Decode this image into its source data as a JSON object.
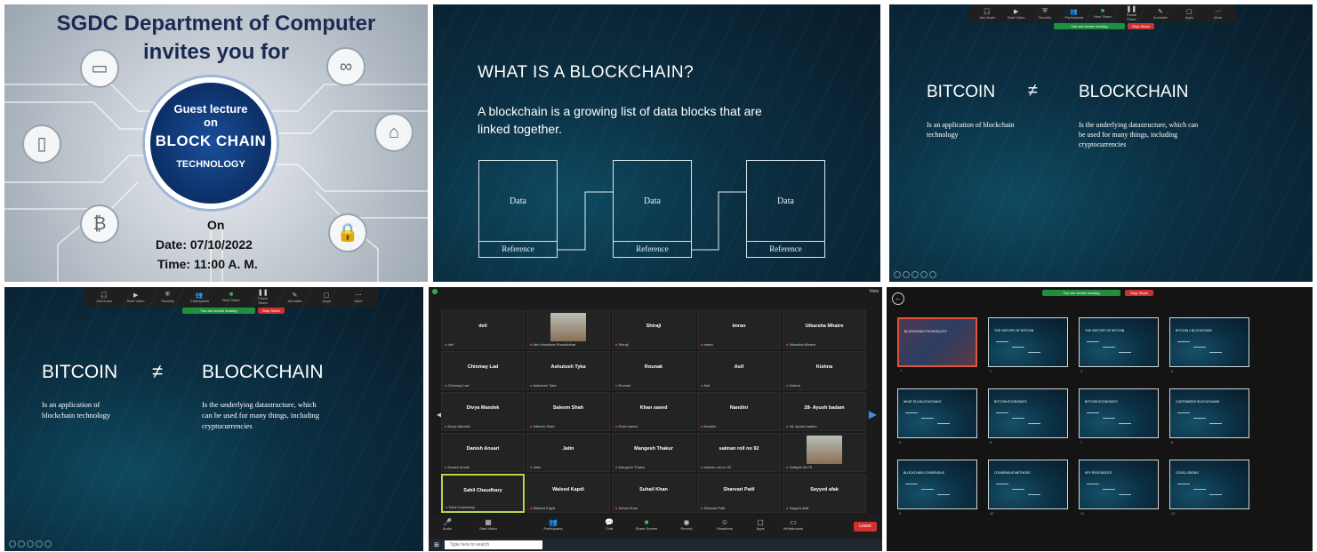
{
  "panel1": {
    "title_line1": "SGDC Department of Computer",
    "title_line2": "invites you for",
    "badge": {
      "line1": "Guest lecture",
      "line2": "on",
      "line3": "BLOCK CHAIN",
      "line4": "TECHNOLOGY"
    },
    "on": "On",
    "date": "Date: 07/10/2022",
    "time": "Time: 11:00 A. M."
  },
  "panel2": {
    "heading": "WHAT IS A BLOCKCHAIN?",
    "body": "A blockchain is a growing list of data blocks that are linked together.",
    "blocks": [
      {
        "data": "Data",
        "ref": "Reference"
      },
      {
        "data": "Data",
        "ref": "Reference"
      },
      {
        "data": "Data",
        "ref": "Reference"
      }
    ]
  },
  "comparison": {
    "left_title": "BITCOIN",
    "symbol": "≠",
    "right_title": "BLOCKCHAIN",
    "left_desc": "Is an application of blockchain technology",
    "right_desc": "Is the underlying datastructure, which can be used for many things, including cryptocurrencies"
  },
  "share_toolbar": {
    "items": [
      "Join Audio",
      "Start Video",
      "Security",
      "Participants",
      "New Share",
      "Pause Share",
      "Annotate",
      "Apps",
      "More"
    ],
    "banner": "You are screen sharing",
    "stop": "Stop Share"
  },
  "gallery": {
    "tiles": [
      {
        "name": "dell",
        "label": "dell"
      },
      {
        "name": "",
        "label": "Anu Harshima Shankhdhar",
        "photo": true
      },
      {
        "name": "Shiraji",
        "label": "Shiraji"
      },
      {
        "name": "Imran",
        "label": "Imran"
      },
      {
        "name": "Utkarsha Mhatre",
        "label": "Utkarsha Mhatre"
      },
      {
        "name": "Chinmay Lad",
        "label": "Chinmay Lad"
      },
      {
        "name": "Ashutosh Tyka",
        "label": "Ashutosh Tyka"
      },
      {
        "name": "Rounak",
        "label": "Rounak"
      },
      {
        "name": "Asif",
        "label": "Asif"
      },
      {
        "name": "Kishna",
        "label": "Kishna"
      },
      {
        "name": "Divya Mandek",
        "label": "Divya Mandek"
      },
      {
        "name": "Saleem Shah",
        "label": "Saleem Shah"
      },
      {
        "name": "Khan saeed",
        "label": "Khan saeed"
      },
      {
        "name": "Nandini",
        "label": "Nandini"
      },
      {
        "name": "28- Ayush badam",
        "label": "28- Ayush badam"
      },
      {
        "name": "Danish Ansari",
        "label": "Danish Ansari"
      },
      {
        "name": "Jatin",
        "label": "Jatin"
      },
      {
        "name": "Mangesh Thakur",
        "label": "Mangesh Thakur"
      },
      {
        "name": "salman roll no 92",
        "label": "salman roll no 92"
      },
      {
        "name": "",
        "label": "Tadhpal 36 FE",
        "photo": true
      },
      {
        "name": "Sahil Chaudhary",
        "label": "Sahil Chaudhary",
        "selected": true
      },
      {
        "name": "Waleed Kapdi",
        "label": "Waleed Kapdi"
      },
      {
        "name": "Suhail Khan",
        "label": "Suhail Khan"
      },
      {
        "name": "Sharvari Patil",
        "label": "Sharvari Patil"
      },
      {
        "name": "Sayyed afak",
        "label": "Sayyed afak"
      }
    ],
    "view_label": "View",
    "controls": [
      "Audio",
      "Start Video",
      "Participants",
      "Chat",
      "Share Screen",
      "Record",
      "Reactions",
      "Apps",
      "Whiteboards"
    ],
    "leave": "Leave",
    "search_placeholder": "Type here to search",
    "participant_count": "84"
  },
  "slides": {
    "banner": "You are screen sharing",
    "stop": "Stop Share",
    "thumbs": [
      {
        "n": "1",
        "title": "BLOCKCHAIN TECHNOLOGY"
      },
      {
        "n": "2",
        "title": "THE HISTORY OF BITCOIN"
      },
      {
        "n": "3",
        "title": "THE HISTORY OF BITCOIN"
      },
      {
        "n": "4",
        "title": "BITCOIN ≠ BLOCKCHAIN"
      },
      {
        "n": "5",
        "title": "WHAT IS A BLOCKCHAIN?"
      },
      {
        "n": "6",
        "title": "BITCOIN ECONOMICS"
      },
      {
        "n": "7",
        "title": "BITCOIN ECONOMICS"
      },
      {
        "n": "8",
        "title": "CUSTOMISED BLOCKCHAINS"
      },
      {
        "n": "9",
        "title": "BLOCKCHAIN CONSENSUS"
      },
      {
        "n": "10",
        "title": "CONSENSUS METHODS"
      },
      {
        "n": "11",
        "title": "KEY RESOURCES"
      },
      {
        "n": "12",
        "title": "CONCLUSIONS"
      }
    ]
  },
  "colors": {
    "slide_bg": "#0b2f42",
    "green": "#1f8f3c",
    "red": "#d0302e",
    "select": "#b4d94a"
  }
}
